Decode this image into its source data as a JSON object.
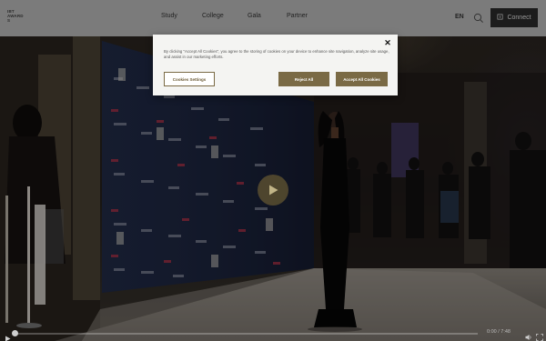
{
  "header": {
    "logo_text": [
      "IBT",
      "AWARD",
      "S"
    ],
    "nav": [
      {
        "label": "Study"
      },
      {
        "label": "College"
      },
      {
        "label": "Gala"
      },
      {
        "label": "Partner"
      }
    ],
    "language": "EN",
    "search_icon": "search-icon",
    "connect_label": "Connect",
    "connect_icon": "user-icon"
  },
  "cookie_banner": {
    "text": "By clicking \"Accept All Cookies\", you agree to the storing of cookies on your device to enhance site navigation, analyze site usage, and assist in our marketing efforts.",
    "close_symbol": "✕",
    "settings_label": "Cookies Settings",
    "reject_label": "Reject All",
    "accept_label": "Accept All Cookies",
    "accent_color": "#7a6a45"
  },
  "video": {
    "current_time": "0:00",
    "duration": "7:48",
    "time_display": "0:00 / 7:48",
    "progress": 0,
    "play_icon": "play-icon",
    "mute_icon": "volume-icon",
    "fullscreen_icon": "fullscreen-icon"
  }
}
